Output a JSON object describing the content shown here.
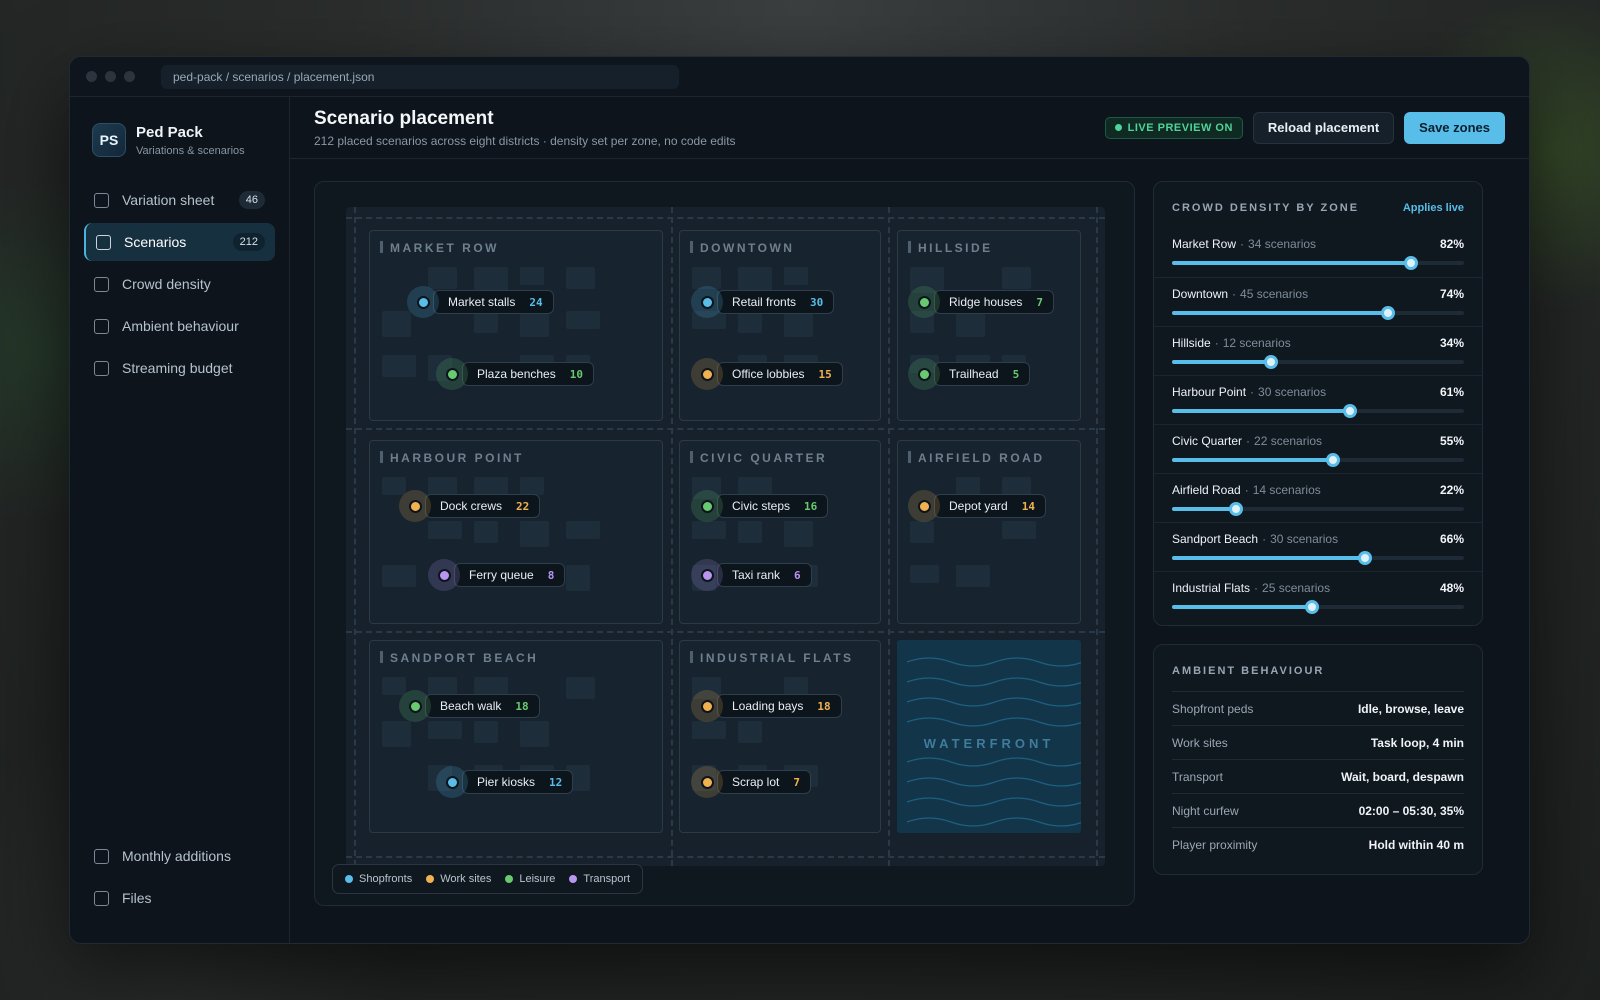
{
  "window": {
    "path": "ped-pack / scenarios / placement.json"
  },
  "brand": {
    "initials": "PS",
    "name": "Ped Pack",
    "subtitle": "Variations & scenarios"
  },
  "nav": [
    {
      "label": "Variation sheet",
      "count": "46"
    },
    {
      "label": "Scenarios",
      "count": "212",
      "active": true
    },
    {
      "label": "Crowd density"
    },
    {
      "label": "Ambient behaviour"
    },
    {
      "label": "Streaming budget"
    }
  ],
  "nav_bottom": [
    {
      "label": "Monthly additions"
    },
    {
      "label": "Files"
    }
  ],
  "header": {
    "title": "Scenario placement",
    "subtitle": "212 placed scenarios across eight districts · density set per zone, no code edits",
    "live_badge": "LIVE PREVIEW ON",
    "reload_label": "Reload placement",
    "save_label": "Save zones"
  },
  "map": {
    "districts": [
      {
        "name": "MARKET ROW",
        "pins": [
          {
            "label": "Market stalls",
            "count": "24",
            "category": "shop"
          },
          {
            "label": "Plaza benches",
            "count": "10",
            "category": "leisure"
          }
        ]
      },
      {
        "name": "DOWNTOWN",
        "pins": [
          {
            "label": "Retail fronts",
            "count": "30",
            "category": "shop"
          },
          {
            "label": "Office lobbies",
            "count": "15",
            "category": "work"
          }
        ]
      },
      {
        "name": "HILLSIDE",
        "pins": [
          {
            "label": "Ridge houses",
            "count": "7",
            "category": "leisure"
          },
          {
            "label": "Trailhead",
            "count": "5",
            "category": "leisure"
          }
        ]
      },
      {
        "name": "HARBOUR POINT",
        "pins": [
          {
            "label": "Dock crews",
            "count": "22",
            "category": "work"
          },
          {
            "label": "Ferry queue",
            "count": "8",
            "category": "transport"
          }
        ]
      },
      {
        "name": "CIVIC QUARTER",
        "pins": [
          {
            "label": "Civic steps",
            "count": "16",
            "category": "leisure"
          },
          {
            "label": "Taxi rank",
            "count": "6",
            "category": "transport"
          }
        ]
      },
      {
        "name": "AIRFIELD ROAD",
        "pins": [
          {
            "label": "Depot yard",
            "count": "14",
            "category": "work"
          }
        ]
      },
      {
        "name": "SANDPORT BEACH",
        "pins": [
          {
            "label": "Beach walk",
            "count": "18",
            "category": "leisure"
          },
          {
            "label": "Pier kiosks",
            "count": "12",
            "category": "shop"
          }
        ]
      },
      {
        "name": "INDUSTRIAL FLATS",
        "pins": [
          {
            "label": "Loading bays",
            "count": "18",
            "category": "work"
          },
          {
            "label": "Scrap lot",
            "count": "7",
            "category": "work"
          }
        ]
      }
    ],
    "waterfront_label": "WATERFRONT",
    "legend": [
      {
        "label": "Shopfronts",
        "color": "#58bde8"
      },
      {
        "label": "Work sites",
        "color": "#f0b250"
      },
      {
        "label": "Leisure",
        "color": "#68c970"
      },
      {
        "label": "Transport",
        "color": "#b896f0"
      }
    ]
  },
  "density": {
    "title": "CROWD DENSITY BY ZONE",
    "link": "Applies live",
    "zones": [
      {
        "name": "Market Row",
        "meta": "34 scenarios",
        "pct": "82%",
        "value": 0.82
      },
      {
        "name": "Downtown",
        "meta": "45 scenarios",
        "pct": "74%",
        "value": 0.74
      },
      {
        "name": "Hillside",
        "meta": "12 scenarios",
        "pct": "34%",
        "value": 0.34
      },
      {
        "name": "Harbour Point",
        "meta": "30 scenarios",
        "pct": "61%",
        "value": 0.61
      },
      {
        "name": "Civic Quarter",
        "meta": "22 scenarios",
        "pct": "55%",
        "value": 0.55
      },
      {
        "name": "Airfield Road",
        "meta": "14 scenarios",
        "pct": "22%",
        "value": 0.22
      },
      {
        "name": "Sandport Beach",
        "meta": "30 scenarios",
        "pct": "66%",
        "value": 0.66
      },
      {
        "name": "Industrial Flats",
        "meta": "25 scenarios",
        "pct": "48%",
        "value": 0.48
      }
    ]
  },
  "ambient": {
    "title": "AMBIENT BEHAVIOUR",
    "rows": [
      {
        "label": "Shopfront peds",
        "value": "Idle, browse, leave"
      },
      {
        "label": "Work sites",
        "value": "Task loop, 4 min"
      },
      {
        "label": "Transport",
        "value": "Wait, board, despawn"
      },
      {
        "label": "Night curfew",
        "value": "02:00 – 05:30, 35%"
      },
      {
        "label": "Player proximity",
        "value": "Hold within 40 m"
      }
    ]
  }
}
